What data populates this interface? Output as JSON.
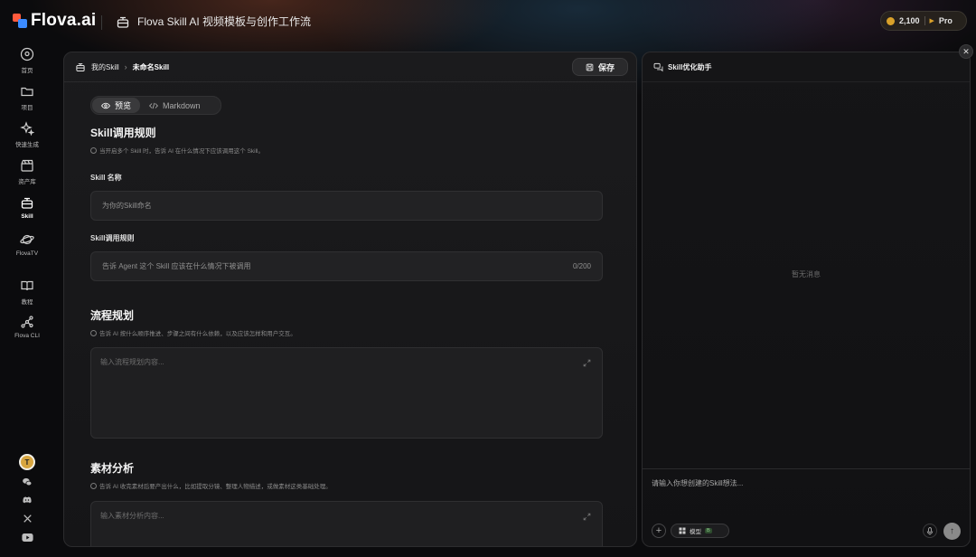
{
  "app": {
    "logo_text": "Flova.ai",
    "title": "Flova Skill AI 视频模板与创作工作流"
  },
  "account": {
    "credits": "2,100",
    "plan": "Pro"
  },
  "sidebar": {
    "items": [
      {
        "label": "首页",
        "icon": "home-icon"
      },
      {
        "label": "项目",
        "icon": "folder-icon"
      },
      {
        "label": "快速生成",
        "icon": "sparkle-icon"
      },
      {
        "label": "资产库",
        "icon": "clapper-icon"
      },
      {
        "label": "Skill",
        "icon": "skill-icon",
        "active": true
      },
      {
        "label": "FlovaTV",
        "icon": "planet-icon"
      },
      {
        "label": "教程",
        "icon": "book-icon"
      },
      {
        "label": "Flova CLI",
        "icon": "node-graph-icon"
      }
    ],
    "avatar_initial": "T",
    "social_icons": [
      "wechat-icon",
      "discord-icon",
      "x-icon",
      "youtube-icon"
    ]
  },
  "editor": {
    "breadcrumb": {
      "root": "我的Skill",
      "current": "未命名Skill"
    },
    "save_label": "保存",
    "view_toggle": {
      "preview": "预览",
      "markdown": "Markdown",
      "selected": "preview"
    },
    "sections": {
      "invoke": {
        "title": "Skill调用规则",
        "hint": "当开启多个 Skill 时，告诉 AI 在什么情况下应该调用这个 Skill。",
        "name_label": "Skill 名称",
        "name_placeholder": "为你的Skill命名",
        "rule_label": "Skill调用规则",
        "rule_placeholder": "告诉 Agent 这个 Skill 应该在什么情况下被调用",
        "rule_count": "0/200"
      },
      "flow": {
        "title": "流程规划",
        "hint": "告诉 AI 按什么顺序推进、步骤之间有什么依赖，以及应该怎样和用户交互。",
        "placeholder": "输入流程规划内容..."
      },
      "material": {
        "title": "素材分析",
        "hint": "告诉 AI 收完素材后要产出什么，比如提取分镜、整理人物描述，或做素材这类基础处理。",
        "placeholder": "输入素材分析内容..."
      }
    }
  },
  "assistant": {
    "title": "Skill优化助手",
    "empty_text": "暂无消息",
    "input_placeholder": "请输入你想创建的Skill想法...",
    "model_label": "模型",
    "model_badge": "B"
  }
}
